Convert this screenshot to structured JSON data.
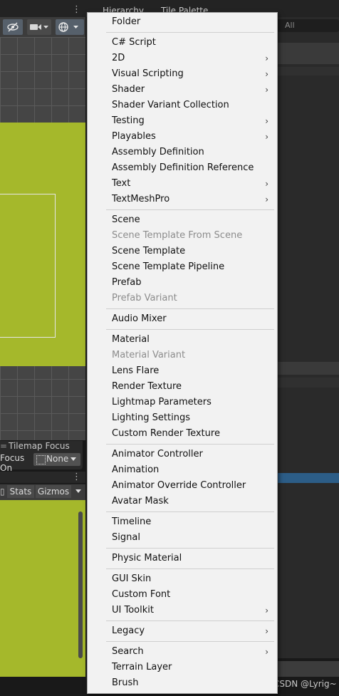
{
  "top_tabs": {
    "hierarchy": "Hierarchy",
    "tile_palette": "Tile Palette"
  },
  "scene_panel": {
    "tilemap_focus": {
      "title": "Tilemap Focus",
      "focus_on_label": "Focus On",
      "focus_value": "None"
    }
  },
  "game_panel": {
    "stats_label": "Stats",
    "gizmos_label": "Gizmos"
  },
  "right_panel": {
    "search_placeholder": "All"
  },
  "watermark": "CSDN @Lyrig~",
  "context_menu": {
    "items": [
      {
        "label": "Folder",
        "submenu": false,
        "enabled": true
      },
      {
        "label": "C# Script",
        "submenu": false,
        "enabled": true
      },
      {
        "label": "2D",
        "submenu": true,
        "enabled": true
      },
      {
        "label": "Visual Scripting",
        "submenu": true,
        "enabled": true
      },
      {
        "label": "Shader",
        "submenu": true,
        "enabled": true
      },
      {
        "label": "Shader Variant Collection",
        "submenu": false,
        "enabled": true
      },
      {
        "label": "Testing",
        "submenu": true,
        "enabled": true
      },
      {
        "label": "Playables",
        "submenu": true,
        "enabled": true
      },
      {
        "label": "Assembly Definition",
        "submenu": false,
        "enabled": true
      },
      {
        "label": "Assembly Definition Reference",
        "submenu": false,
        "enabled": true
      },
      {
        "label": "Text",
        "submenu": true,
        "enabled": true
      },
      {
        "label": "TextMeshPro",
        "submenu": true,
        "enabled": true
      },
      {
        "label": "Scene",
        "submenu": false,
        "enabled": true
      },
      {
        "label": "Scene Template From Scene",
        "submenu": false,
        "enabled": false
      },
      {
        "label": "Scene Template",
        "submenu": false,
        "enabled": true
      },
      {
        "label": "Scene Template Pipeline",
        "submenu": false,
        "enabled": true
      },
      {
        "label": "Prefab",
        "submenu": false,
        "enabled": true
      },
      {
        "label": "Prefab Variant",
        "submenu": false,
        "enabled": false
      },
      {
        "label": "Audio Mixer",
        "submenu": false,
        "enabled": true
      },
      {
        "label": "Material",
        "submenu": false,
        "enabled": true
      },
      {
        "label": "Material Variant",
        "submenu": false,
        "enabled": false
      },
      {
        "label": "Lens Flare",
        "submenu": false,
        "enabled": true
      },
      {
        "label": "Render Texture",
        "submenu": false,
        "enabled": true
      },
      {
        "label": "Lightmap Parameters",
        "submenu": false,
        "enabled": true
      },
      {
        "label": "Lighting Settings",
        "submenu": false,
        "enabled": true
      },
      {
        "label": "Custom Render Texture",
        "submenu": false,
        "enabled": true
      },
      {
        "label": "Animator Controller",
        "submenu": false,
        "enabled": true
      },
      {
        "label": "Animation",
        "submenu": false,
        "enabled": true
      },
      {
        "label": "Animator Override Controller",
        "submenu": false,
        "enabled": true
      },
      {
        "label": "Avatar Mask",
        "submenu": false,
        "enabled": true
      },
      {
        "label": "Timeline",
        "submenu": false,
        "enabled": true
      },
      {
        "label": "Signal",
        "submenu": false,
        "enabled": true
      },
      {
        "label": "Physic Material",
        "submenu": false,
        "enabled": true
      },
      {
        "label": "GUI Skin",
        "submenu": false,
        "enabled": true
      },
      {
        "label": "Custom Font",
        "submenu": false,
        "enabled": true
      },
      {
        "label": "UI Toolkit",
        "submenu": true,
        "enabled": true
      },
      {
        "label": "Legacy",
        "submenu": true,
        "enabled": true
      },
      {
        "label": "Search",
        "submenu": true,
        "enabled": true
      },
      {
        "label": "Terrain Layer",
        "submenu": false,
        "enabled": true
      },
      {
        "label": "Brush",
        "submenu": false,
        "enabled": true
      }
    ]
  },
  "colors": {
    "tile_green": "#a5b82b",
    "menu_background": "#f2f2f2",
    "disabled_text": "#8c8c8c",
    "selection_blue": "#2c5d87"
  }
}
